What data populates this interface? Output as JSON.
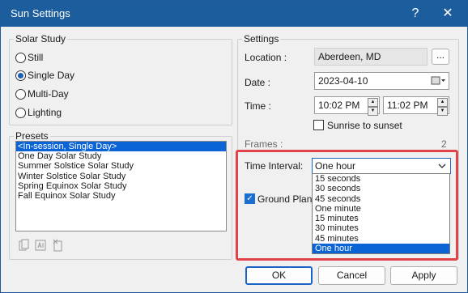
{
  "window": {
    "title": "Sun Settings",
    "help_glyph": "?",
    "close_glyph": "✕"
  },
  "solar_study": {
    "label": "Solar Study",
    "options": [
      {
        "label": "Still",
        "checked": false
      },
      {
        "label": "Single Day",
        "checked": true
      },
      {
        "label": "Multi-Day",
        "checked": false
      },
      {
        "label": "Lighting",
        "checked": false
      }
    ]
  },
  "presets": {
    "label": "Presets",
    "items": [
      "<In-session, Single Day>",
      "One Day Solar Study",
      "Summer Solstice Solar Study",
      "Winter Solstice Solar Study",
      "Spring Equinox Solar Study",
      "Fall Equinox Solar Study"
    ],
    "selected_index": 0,
    "icons": [
      "duplicate-icon",
      "rename-icon",
      "delete-icon"
    ]
  },
  "settings": {
    "label": "Settings",
    "location_label": "Location :",
    "location_value": "Aberdeen, MD",
    "browse_label": "...",
    "date_label": "Date :",
    "date_value": "2023-04-10",
    "time_label": "Time :",
    "time_start": "10:02 PM",
    "time_end": "11:02 PM",
    "sunrise_label": "Sunrise to sunset",
    "sunrise_checked": false,
    "frames_label": "Frames :",
    "frames_value": "2",
    "interval_label": "Time Interval:",
    "interval_value": "One hour",
    "ground_plane_label": "Ground Plane at",
    "ground_plane_checked": true,
    "interval_options": [
      "15 seconds",
      "30 seconds",
      "45 seconds",
      "One minute",
      "15 minutes",
      "30 minutes",
      "45 minutes",
      "One hour"
    ],
    "interval_selected_index": 7
  },
  "buttons": {
    "ok": "OK",
    "cancel": "Cancel",
    "apply": "Apply"
  },
  "colors": {
    "titlebar": "#1c5d9e",
    "selection": "#0a64d6",
    "highlight_border": "#e0444a"
  }
}
